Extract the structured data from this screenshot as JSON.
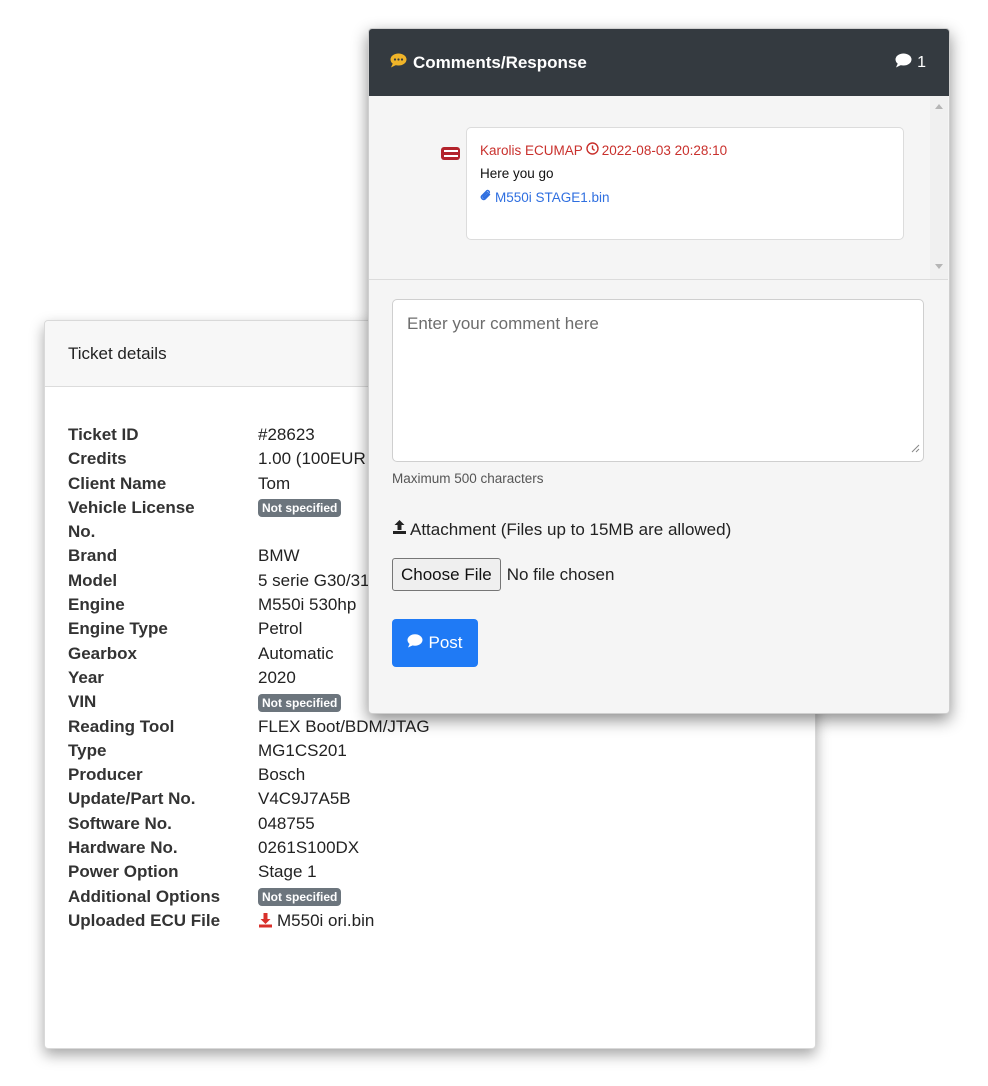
{
  "ticket": {
    "header": "Ticket details",
    "rows": [
      {
        "label": "Ticket ID",
        "value": "#28623"
      },
      {
        "label": "Credits",
        "value": "1.00 (100EUR"
      },
      {
        "label": "Client Name",
        "value": "Tom"
      },
      {
        "label": "Vehicle License No.",
        "badge": "Not specified"
      },
      {
        "label": "Brand",
        "value": "BMW"
      },
      {
        "label": "Model",
        "value": "5 serie G30/31"
      },
      {
        "label": "Engine",
        "value": "M550i 530hp"
      },
      {
        "label": "Engine Type",
        "value": "Petrol"
      },
      {
        "label": "Gearbox",
        "value": "Automatic"
      },
      {
        "label": "Year",
        "value": "2020"
      },
      {
        "label": "VIN",
        "badge": "Not specified"
      },
      {
        "label": "Reading Tool",
        "value": "FLEX Boot/BDM/JTAG"
      },
      {
        "label": "Type",
        "value": "MG1CS201"
      },
      {
        "label": "Producer",
        "value": "Bosch"
      },
      {
        "label": "Update/Part No.",
        "value": "V4C9J7A5B"
      },
      {
        "label": "Software No.",
        "value": "048755"
      },
      {
        "label": "Hardware No.",
        "value": "0261S100DX"
      },
      {
        "label": "Power Option",
        "value": "Stage 1"
      },
      {
        "label": "Additional Options",
        "badge": "Not specified"
      },
      {
        "label": "Uploaded ECU File",
        "link": "M550i ori.bin"
      }
    ]
  },
  "comments": {
    "title": "Comments/Response",
    "count": "1",
    "message": {
      "author": "Karolis ECUMAP",
      "timestamp": "2022-08-03 20:28:10",
      "text": "Here you go",
      "attachment": "M550i STAGE1.bin"
    },
    "form": {
      "placeholder": "Enter your comment here",
      "hint": "Maximum 500 characters",
      "attachment_label": "Attachment (Files up to 15MB are allowed)",
      "choose_file": "Choose File",
      "no_file": "No file chosen",
      "post_label": "Post"
    }
  },
  "colors": {
    "header_dark": "#343a40",
    "author_red": "#c9302c",
    "link_blue": "#2f6fe0",
    "badge_gray": "#6c757d",
    "post_blue": "#1f7af5",
    "download_red": "#d9302b"
  }
}
